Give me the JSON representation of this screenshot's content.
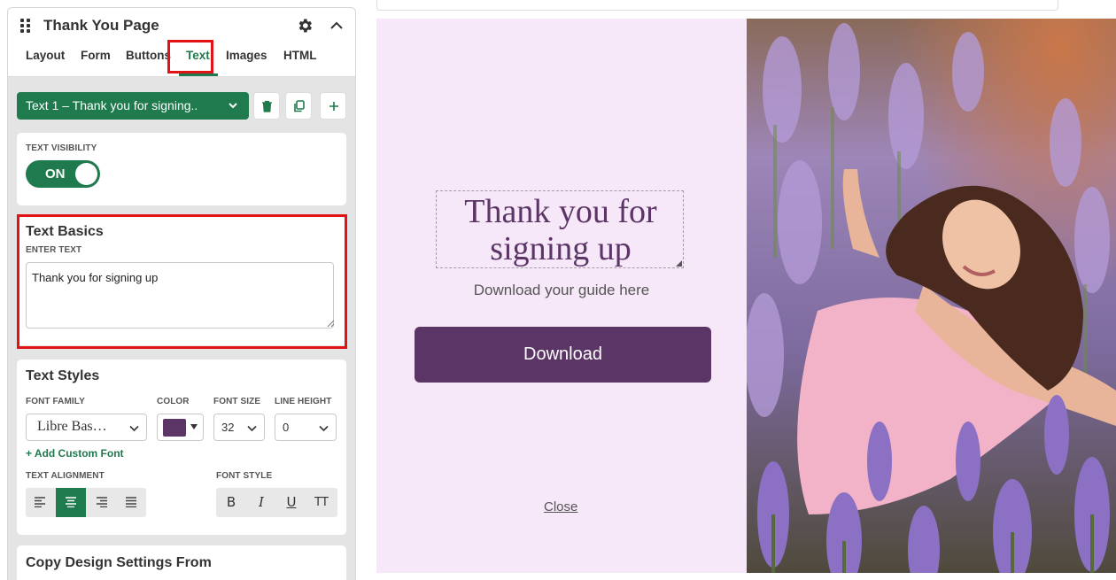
{
  "panel": {
    "title": "Thank You Page",
    "tabs": [
      "Layout",
      "Form",
      "Buttons",
      "Text",
      "Images",
      "HTML"
    ],
    "active_tab": "Text"
  },
  "text_selector": {
    "value": "Text 1 – Thank you for signing.."
  },
  "visibility": {
    "caption": "TEXT VISIBILITY",
    "toggle_label": "ON"
  },
  "text_basics": {
    "title": "Text Basics",
    "caption": "ENTER TEXT",
    "value": "Thank you for signing up"
  },
  "text_styles": {
    "title": "Text Styles",
    "font_family_caption": "FONT FAMILY",
    "color_caption": "COLOR",
    "font_size_caption": "FONT SIZE",
    "line_height_caption": "LINE HEIGHT",
    "font_family": "Libre Bas…",
    "color": "#5b3566",
    "font_size": "32",
    "line_height": "0",
    "add_custom_font": "+ Add Custom Font",
    "alignment_caption": "TEXT ALIGNMENT",
    "font_style_caption": "FONT STYLE",
    "font_style_buttons": [
      "B",
      "I",
      "U",
      "TT"
    ],
    "active_alignment": "center"
  },
  "copy_design": {
    "title": "Copy Design Settings From"
  },
  "preview": {
    "heading": "Thank you for signing up",
    "subtext": "Download your guide here",
    "button_label": "Download",
    "close_label": "Close",
    "background": "#f6e7f9",
    "accent": "#5b3566"
  },
  "colors": {
    "brand_green": "#1f7a4d",
    "highlight_red": "#e01414"
  }
}
